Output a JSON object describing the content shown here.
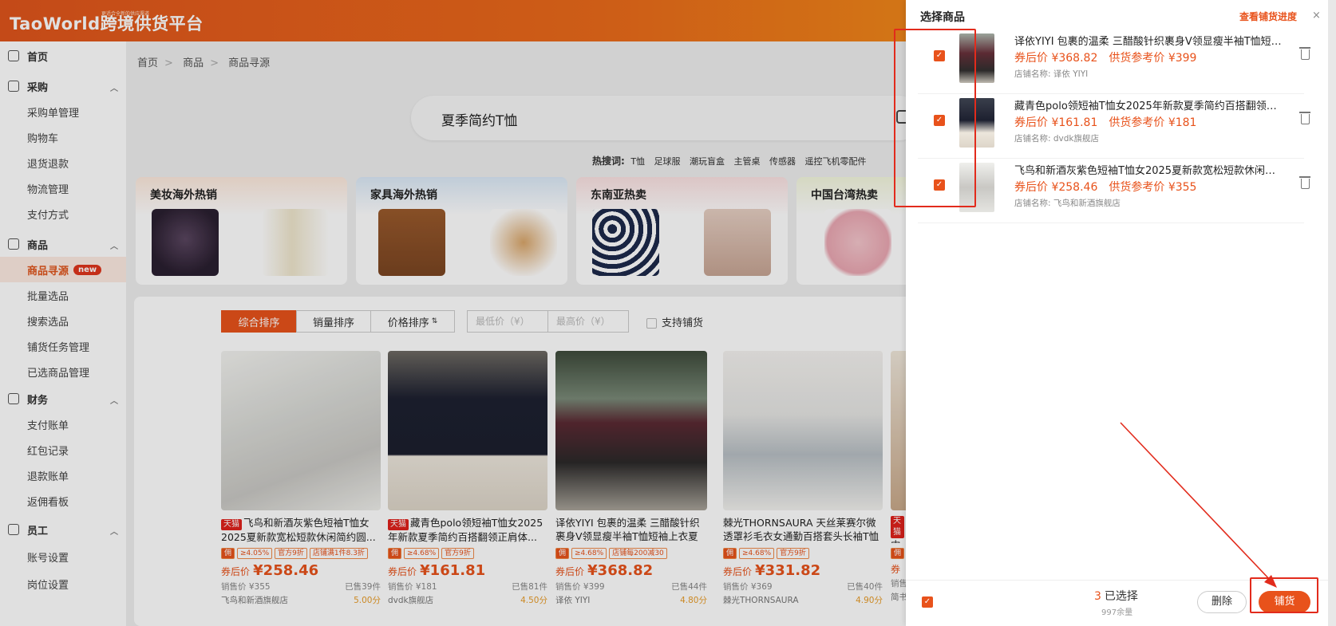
{
  "header": {
    "logo_text": "TaoWorld跨境供货平台",
    "logo_sub": "更适合全新的供应渠道"
  },
  "sidebar": {
    "groups": [
      {
        "label": "首页",
        "icon": "home-icon"
      },
      {
        "label": "采购",
        "icon": "cart-icon",
        "items": [
          "采购单管理",
          "购物车",
          "退货退款",
          "物流管理",
          "支付方式"
        ]
      },
      {
        "label": "商品",
        "icon": "box-icon",
        "items": [
          "商品寻源",
          "批量选品",
          "搜索选品",
          "铺货任务管理",
          "已选商品管理"
        ],
        "active": "商品寻源",
        "badge": "new"
      },
      {
        "label": "财务",
        "icon": "finance-icon",
        "items": [
          "支付账单",
          "红包记录",
          "退款账单",
          "返佣看板"
        ]
      },
      {
        "label": "员工",
        "icon": "staff-icon",
        "items": [
          "账号设置",
          "岗位设置"
        ]
      }
    ]
  },
  "breadcrumb": [
    "首页",
    "商品",
    "商品寻源"
  ],
  "search": {
    "value": "夏季简约T恤"
  },
  "hot": {
    "label": "热搜词:",
    "words": [
      "T恤",
      "足球服",
      "潮玩盲盒",
      "主管桌",
      "传感器",
      "遥控飞机零配件"
    ]
  },
  "categories": [
    "美妆海外热销",
    "家具海外热销",
    "东南亚热卖",
    "中国台湾热卖"
  ],
  "sort": {
    "tabs": [
      "综合排序",
      "销量排序",
      "价格排序"
    ],
    "min_placeholder": "最低价（¥）",
    "max_placeholder": "最高价（¥）",
    "dropship_label": "支持铺货"
  },
  "products": [
    {
      "tmall": "天猫",
      "title": "飞鸟和新酒灰紫色短袖T恤女2025夏新款宽松短款休闲简约圆...",
      "tags": [
        "佣",
        "≥4.05%",
        "官方9折",
        "店铺满1件8.3折"
      ],
      "price_label": "券后价",
      "price": "¥258.46",
      "sale": "销售价 ¥355",
      "sold": "已售39件",
      "shop": "飞鸟和新酒旗舰店",
      "score": "5.00分"
    },
    {
      "tmall": "天猫",
      "title": "藏青色polo领短袖T恤女2025年新款夏季简约百搭翻领正肩体...",
      "tags": [
        "佣",
        "≥4.68%",
        "官方9折"
      ],
      "price_label": "券后价",
      "price": "¥161.81",
      "sale": "销售价 ¥181",
      "sold": "已售81件",
      "shop": "dvdk旗舰店",
      "score": "4.50分"
    },
    {
      "tmall": "",
      "title": "译依YIYI 包裹的温柔 三醋酸针织裹身V领显瘦半袖T恤短袖上衣夏季",
      "tags": [
        "佣",
        "≥4.68%",
        "店铺每200减30"
      ],
      "price_label": "券后价",
      "price": "¥368.82",
      "sale": "销售价 ¥399",
      "sold": "已售44件",
      "shop": "译依 YIYI",
      "score": "4.80分"
    },
    {
      "tmall": "",
      "title": "棘光THORNSAURA 天丝莱赛尔微透罩衫毛衣女通勤百搭套头长袖T恤",
      "tags": [
        "佣",
        "≥4.68%",
        "官方9折"
      ],
      "price_label": "券后价",
      "price": "¥331.82",
      "sale": "销售价 ¥369",
      "sold": "已售40件",
      "shop": "棘光THORNSAURA",
      "score": "4.90分"
    },
    {
      "tmall": "天猫",
      "title": "内搭",
      "tags": [
        "佣"
      ],
      "price_label": "券",
      "price": "",
      "sale": "销售",
      "sold": "",
      "shop": "简书",
      "score": ""
    }
  ],
  "drawer": {
    "title": "选择商品",
    "link": "查看铺货进度",
    "close": "×",
    "items": [
      {
        "title": "译依YIYI 包裹的温柔 三醋酸针织裹身V领显瘦半袖T恤短袖上...",
        "price_label": "券后价",
        "price": "¥368.82",
        "ref_label": "供货参考价",
        "ref": "¥399",
        "shop": "店铺名称:  译依 YIYI"
      },
      {
        "title": "藏青色polo领短袖T恤女2025年新款夏季简约百搭翻领正肩...",
        "price_label": "券后价",
        "price": "¥161.81",
        "ref_label": "供货参考价",
        "ref": "¥181",
        "shop": "店铺名称:  dvdk旗舰店"
      },
      {
        "title": "飞鸟和新酒灰紫色短袖T恤女2025夏新款宽松短款休闲简约...",
        "price_label": "券后价",
        "price": "¥258.46",
        "ref_label": "供货参考价",
        "ref": "¥355",
        "shop": "店铺名称:  飞鸟和新酒旗舰店"
      }
    ],
    "footer": {
      "count": "3",
      "count_label": "已选择",
      "remain": "997余量",
      "delete": "删除",
      "publish": "铺货"
    }
  },
  "colors": {
    "accent": "#e8521b",
    "annotation": "#e22b1c"
  }
}
